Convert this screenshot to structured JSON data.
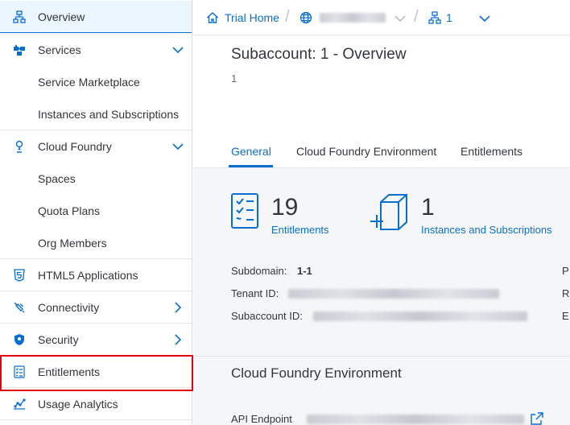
{
  "sidebar": {
    "items": [
      {
        "label": "Overview"
      },
      {
        "label": "Services"
      },
      {
        "label": "Service Marketplace"
      },
      {
        "label": "Instances and Subscriptions"
      },
      {
        "label": "Cloud Foundry"
      },
      {
        "label": "Spaces"
      },
      {
        "label": "Quota Plans"
      },
      {
        "label": "Org Members"
      },
      {
        "label": "HTML5 Applications"
      },
      {
        "label": "Connectivity"
      },
      {
        "label": "Security"
      },
      {
        "label": "Entitlements"
      },
      {
        "label": "Usage Analytics"
      }
    ]
  },
  "header": {
    "home_label": "Trial Home",
    "subaccount_label": "1"
  },
  "page": {
    "title": "Subaccount: 1 - Overview",
    "subtitle": "1",
    "tabs": [
      {
        "label": "General"
      },
      {
        "label": "Cloud Foundry Environment"
      },
      {
        "label": "Entitlements"
      }
    ]
  },
  "kpis": {
    "entitlements": {
      "value": "19",
      "label": "Entitlements"
    },
    "instances": {
      "value": "1",
      "label": "Instances and Subscriptions"
    }
  },
  "details": {
    "subdomain_label": "Subdomain:",
    "subdomain_value": "1-1",
    "tenant_label": "Tenant ID:",
    "subaccount_id_label": "Subaccount ID:",
    "cut_labels": [
      "P",
      "R",
      "E"
    ]
  },
  "cf_section": {
    "title": "Cloud Foundry Environment",
    "api_label": "API Endpoint"
  },
  "colors": {
    "accent": "#0a6ed1",
    "highlight": "#e8000b",
    "text": "#32363a"
  }
}
